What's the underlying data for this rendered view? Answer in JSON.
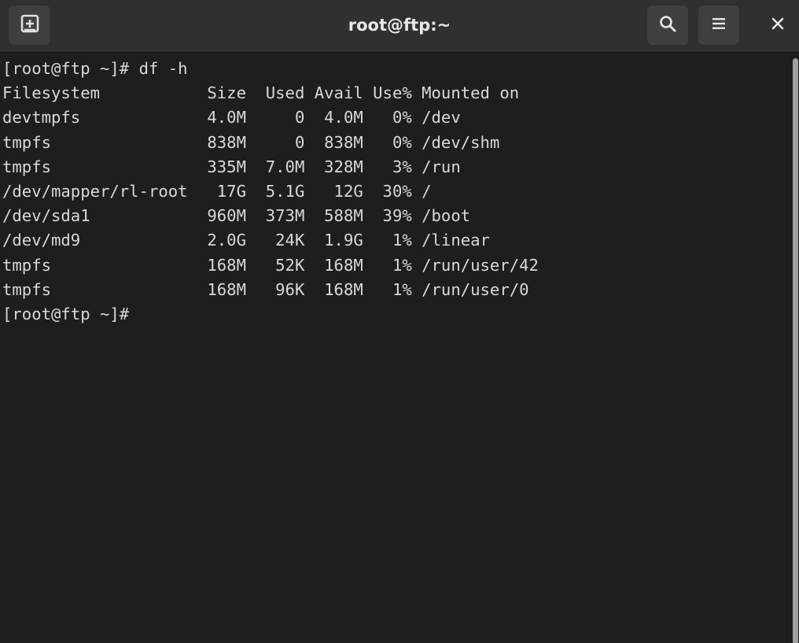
{
  "window": {
    "title": "root@ftp:~"
  },
  "toolbar": {
    "new_tab_icon": "new-tab-icon",
    "search_icon": "search-icon",
    "menu_icon": "hamburger-menu-icon",
    "close_icon": "close-icon"
  },
  "terminal": {
    "lines": [
      "[root@ftp ~]# df -h",
      "Filesystem           Size  Used Avail Use% Mounted on",
      "devtmpfs             4.0M     0  4.0M   0% /dev",
      "tmpfs                838M     0  838M   0% /dev/shm",
      "tmpfs                335M  7.0M  328M   3% /run",
      "/dev/mapper/rl-root   17G  5.1G   12G  30% /",
      "/dev/sda1            960M  373M  588M  39% /boot",
      "/dev/md9             2.0G   24K  1.9G   1% /linear",
      "tmpfs                168M   52K  168M   1% /run/user/42",
      "tmpfs                168M   96K  168M   1% /run/user/0",
      "[root@ftp ~]#"
    ]
  },
  "colors": {
    "background": "#1e1e1e",
    "titlebar": "#303030",
    "button": "#3f3f3f",
    "text": "#d8d8d8",
    "title_text": "#e8e8e8"
  }
}
